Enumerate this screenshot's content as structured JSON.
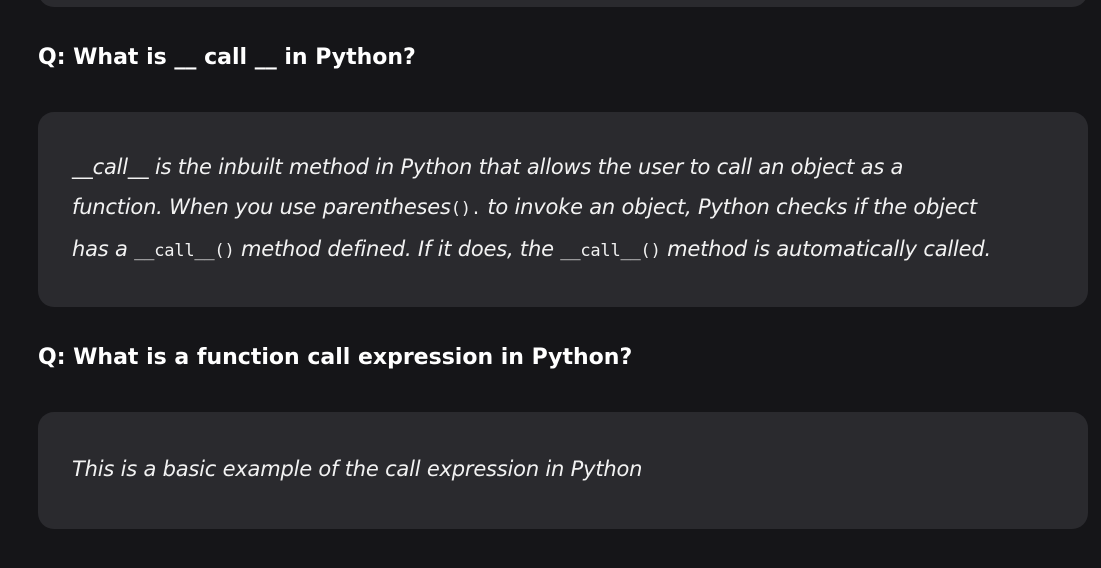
{
  "faq": [
    {
      "question": "Q: What is __ call __ in Python?",
      "answer": {
        "line1_prefix": "__call__",
        "line1_rest": " is the inbuilt method in Python that allows the user to call an object as a",
        "line2_text": "function. When you use parentheses",
        "line2_code": "().",
        "line2_rest": " to invoke an object, Python checks if the object",
        "line3_text": "has a ",
        "line3_code1": "__call__()",
        "line3_mid": " method defined. If it does, the ",
        "line3_code2": "__call__()",
        "line3_rest": " method is automatically called."
      }
    },
    {
      "question": "Q: What is a function call expression in Python?",
      "answer": {
        "text": "This is a basic example of the call expression in Python"
      }
    }
  ]
}
